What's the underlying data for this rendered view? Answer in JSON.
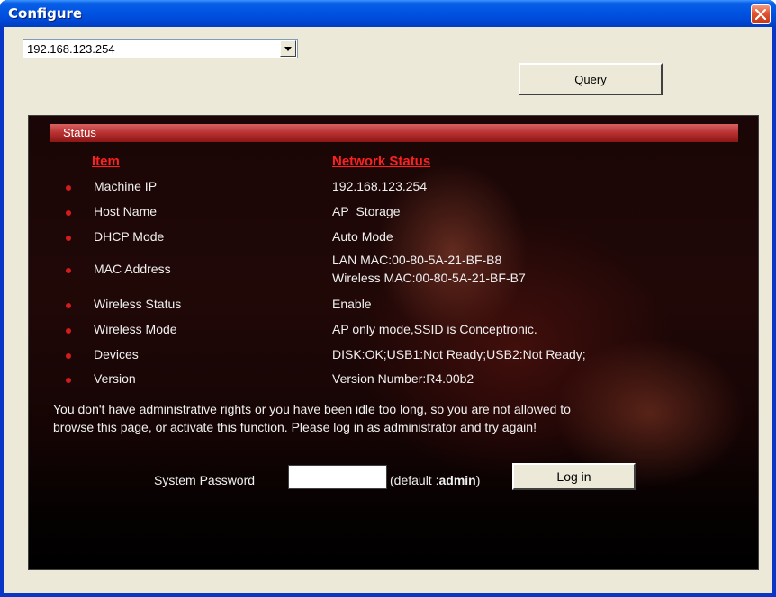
{
  "window": {
    "title": "Configure"
  },
  "address_combo": {
    "value": "192.168.123.254"
  },
  "query_button": {
    "label": "Query"
  },
  "status": {
    "section_title": "Status",
    "col_item": "Item",
    "col_status": "Network Status",
    "rows": [
      {
        "item": "Machine IP",
        "value": "192.168.123.254",
        "value2": ""
      },
      {
        "item": "Host Name",
        "value": "AP_Storage",
        "value2": ""
      },
      {
        "item": "DHCP Mode",
        "value": "Auto Mode",
        "value2": ""
      },
      {
        "item": "MAC Address",
        "value": "LAN MAC:00-80-5A-21-BF-B8",
        "value2": "Wireless MAC:00-80-5A-21-BF-B7"
      },
      {
        "item": "Wireless Status",
        "value": "Enable",
        "value2": ""
      },
      {
        "item": "Wireless Mode",
        "value": "AP only mode,SSID is Conceptronic.",
        "value2": ""
      },
      {
        "item": "Devices",
        "value": "DISK:OK;USB1:Not Ready;USB2:Not Ready;",
        "value2": ""
      },
      {
        "item": "Version",
        "value": "Version Number:R4.00b2",
        "value2": ""
      }
    ],
    "notice_line1": "You don't have administrative rights or you have been idle too long, so you are not allowed to",
    "notice_line2": "browse this page, or activate this function. Please log in as administrator and try again!"
  },
  "login": {
    "password_label": "System Password",
    "default_prefix": "(default :",
    "default_value": "admin",
    "default_suffix": ")",
    "button_label": "Log in"
  },
  "colors": {
    "titlebar": "#0054e3",
    "status_bar": "#b73030",
    "header_text": "#ff2020",
    "bullet": "#d41c1c"
  }
}
